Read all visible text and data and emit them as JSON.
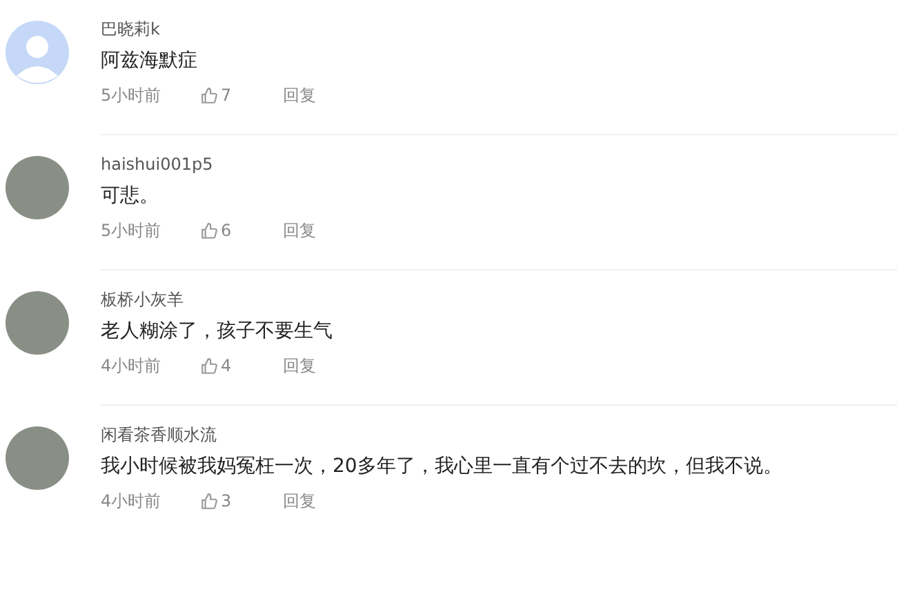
{
  "comments": [
    {
      "kind": "default",
      "username": "巴晓莉k",
      "text": "阿兹海默症",
      "time": "5小时前",
      "likes": "7",
      "reply": "回复"
    },
    {
      "kind": "photo",
      "username": "haishui001p5",
      "text": "可悲。",
      "time": "5小时前",
      "likes": "6",
      "reply": "回复"
    },
    {
      "kind": "photo",
      "username": "板桥小灰羊",
      "text": "老人糊涂了，孩子不要生气",
      "time": "4小时前",
      "likes": "4",
      "reply": "回复"
    },
    {
      "kind": "photo",
      "username": "闲看茶香顺水流",
      "text": "我小时候被我妈冤枉一次，20多年了，我心里一直有个过不去的坎，但我不说。",
      "time": "4小时前",
      "likes": "3",
      "reply": "回复"
    }
  ]
}
